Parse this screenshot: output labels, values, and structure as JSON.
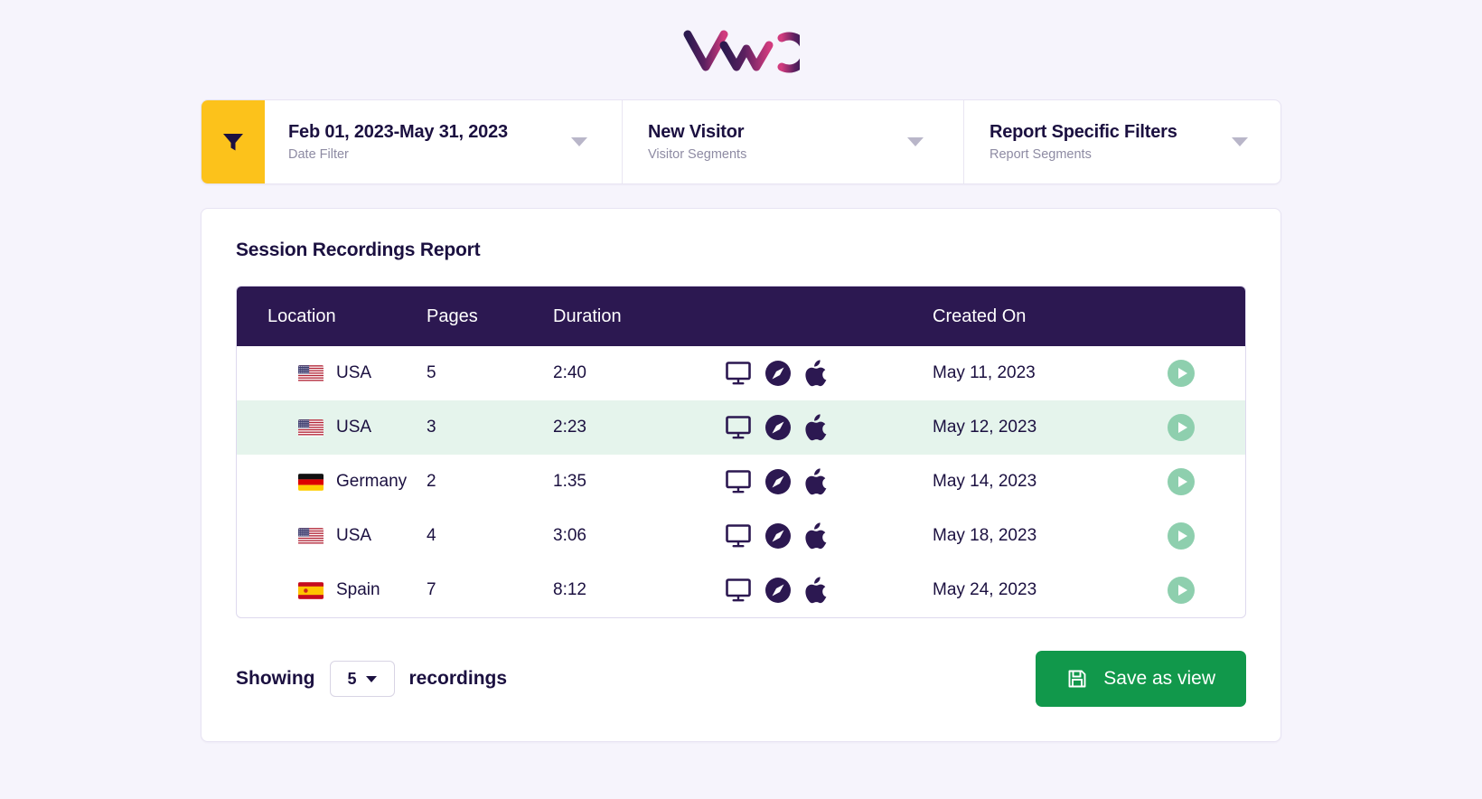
{
  "brand": {
    "logo_name": "VWO",
    "logo_gradient_start": "#2b1a4f",
    "logo_gradient_end": "#d13b7e"
  },
  "filters": {
    "funnel_icon": "funnel-icon",
    "funnel_bg": "#fcc21b",
    "items": [
      {
        "title": "Feb 01, 2023-May 31, 2023",
        "subtitle": "Date Filter"
      },
      {
        "title": "New Visitor",
        "subtitle": "Visitor Segments"
      },
      {
        "title": "Report Specific Filters",
        "subtitle": "Report Segments"
      }
    ]
  },
  "report": {
    "title": "Session Recordings Report",
    "header_bg": "#2c1851",
    "highlight_bg": "#e5f4ec",
    "columns": [
      "Location",
      "Pages",
      "Duration",
      "",
      "Created On",
      "",
      ""
    ],
    "rows": [
      {
        "flag": "flag-usa",
        "location": "USA",
        "pages": "5",
        "duration": "2:40",
        "device": "desktop-icon",
        "browser": "safari-icon",
        "os": "apple-icon",
        "created_on": "May 11, 2023",
        "highlighted": false
      },
      {
        "flag": "flag-usa",
        "location": "USA",
        "pages": "3",
        "duration": "2:23",
        "device": "desktop-icon",
        "browser": "safari-icon",
        "os": "apple-icon",
        "created_on": "May 12, 2023",
        "highlighted": true
      },
      {
        "flag": "flag-germany",
        "location": "Germany",
        "pages": "2",
        "duration": "1:35",
        "device": "desktop-icon",
        "browser": "safari-icon",
        "os": "apple-icon",
        "created_on": "May 14, 2023",
        "highlighted": false
      },
      {
        "flag": "flag-usa",
        "location": "USA",
        "pages": "4",
        "duration": "3:06",
        "device": "desktop-icon",
        "browser": "safari-icon",
        "os": "apple-icon",
        "created_on": "May 18, 2023",
        "highlighted": false
      },
      {
        "flag": "flag-spain",
        "location": "Spain",
        "pages": "7",
        "duration": "8:12",
        "device": "desktop-icon",
        "browser": "safari-icon",
        "os": "apple-icon",
        "created_on": "May 24, 2023",
        "highlighted": false
      }
    ],
    "play_icon": "play-icon",
    "play_bg": "#8ecfae",
    "menu_icon": "kebab-menu-icon"
  },
  "footer": {
    "showing_label": "Showing",
    "count_value": "5",
    "recordings_label": "recordings",
    "save_label": "Save as view",
    "save_icon": "save-disk-icon",
    "save_bg": "#11984b"
  }
}
